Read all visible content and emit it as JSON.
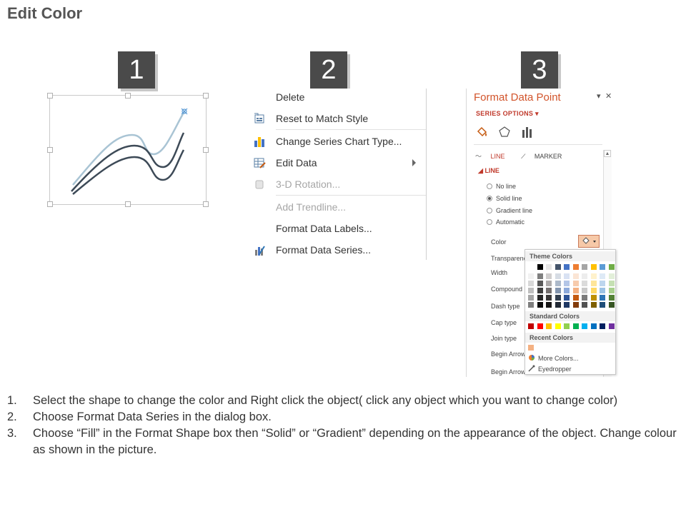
{
  "page": {
    "title": "Edit Color"
  },
  "steps": [
    {
      "number": "1"
    },
    {
      "number": "2"
    },
    {
      "number": "3"
    }
  ],
  "context_menu": {
    "items": [
      {
        "label": "Delete",
        "icon": "none",
        "disabled": false
      },
      {
        "label": "Reset to Match Style",
        "icon": "reset-style-icon",
        "disabled": false
      },
      {
        "label": "Change Series Chart Type...",
        "icon": "bar-chart-icon",
        "disabled": false
      },
      {
        "label": "Edit Data",
        "icon": "table-edit-icon",
        "disabled": false,
        "submenu": true
      },
      {
        "label": "3-D Rotation...",
        "icon": "cube-icon",
        "disabled": true
      },
      {
        "label": "Add Trendline...",
        "icon": "none",
        "disabled": true
      },
      {
        "label": "Format Data Labels...",
        "icon": "none",
        "disabled": false
      },
      {
        "label": "Format Data Series...",
        "icon": "format-series-icon",
        "disabled": false
      }
    ]
  },
  "format_pane": {
    "title": "Format Data Point",
    "series_options": "SERIES OPTIONS",
    "tabs": {
      "line": "LINE",
      "marker": "MARKER"
    },
    "section": "LINE",
    "radios": [
      {
        "label": "No line",
        "checked": false
      },
      {
        "label": "Solid line",
        "checked": true
      },
      {
        "label": "Gradient line",
        "checked": false
      },
      {
        "label": "Automatic",
        "checked": false
      }
    ],
    "props": [
      "Color",
      "Transparenc",
      "Width",
      "Compound",
      "Dash type",
      "Cap type",
      "Join type",
      "Begin Arrow",
      "Begin Arrow"
    ],
    "palette": {
      "theme_header": "Theme Colors",
      "standard_header": "Standard Colors",
      "recent_header": "Recent Colors",
      "more_colors": "More Colors...",
      "eyedropper": "Eyedropper",
      "theme_top": [
        "#ffffff",
        "#000000",
        "#e7e6e6",
        "#44546a",
        "#4472c4",
        "#ed7d31",
        "#a5a5a5",
        "#ffc000",
        "#5b9bd5",
        "#70ad47"
      ],
      "theme_shades": [
        [
          "#f2f2f2",
          "#7f7f7f",
          "#d0cece",
          "#d6dce4",
          "#d9e2f3",
          "#fbe5d5",
          "#ededed",
          "#fff2cc",
          "#deeaf6",
          "#e2efd9"
        ],
        [
          "#d8d8d8",
          "#595959",
          "#aeabab",
          "#acb9ca",
          "#b4c6e7",
          "#f7cbac",
          "#dbdbdb",
          "#fee599",
          "#bdd6ee",
          "#c5e0b3"
        ],
        [
          "#bfbfbf",
          "#3f3f3f",
          "#757070",
          "#8496b0",
          "#8eaadb",
          "#f4b183",
          "#c9c9c9",
          "#ffd965",
          "#9cc3e5",
          "#a8d08d"
        ],
        [
          "#a5a5a5",
          "#262626",
          "#3a3838",
          "#323f4f",
          "#2f5496",
          "#c55a11",
          "#7b7b7b",
          "#bf9000",
          "#2e75b5",
          "#538135"
        ],
        [
          "#7f7f7f",
          "#0c0c0c",
          "#171616",
          "#222a35",
          "#1f3864",
          "#833c0b",
          "#525252",
          "#7f6000",
          "#1e4e79",
          "#375623"
        ]
      ],
      "standard": [
        "#c00000",
        "#ff0000",
        "#ffc000",
        "#ffff00",
        "#92d050",
        "#00b050",
        "#00b0f0",
        "#0070c0",
        "#002060",
        "#7030a0"
      ],
      "recent": [
        "#f4b183"
      ]
    }
  },
  "chart_preview": {
    "line_colors": [
      "#a9c4d4",
      "#3d4a57",
      "#3d4a57"
    ]
  },
  "instructions": [
    {
      "num": "1.",
      "text": "Select the shape to change the color and Right click the object( click any object which you want to change color)"
    },
    {
      "num": "2.",
      "text": "Choose Format Data Series in the dialog box."
    },
    {
      "num": "3.",
      "text": "Choose “Fill” in the Format Shape box then “Solid” or “Gradient” depending on the appearance of the object. Change colour as shown in the picture."
    }
  ]
}
